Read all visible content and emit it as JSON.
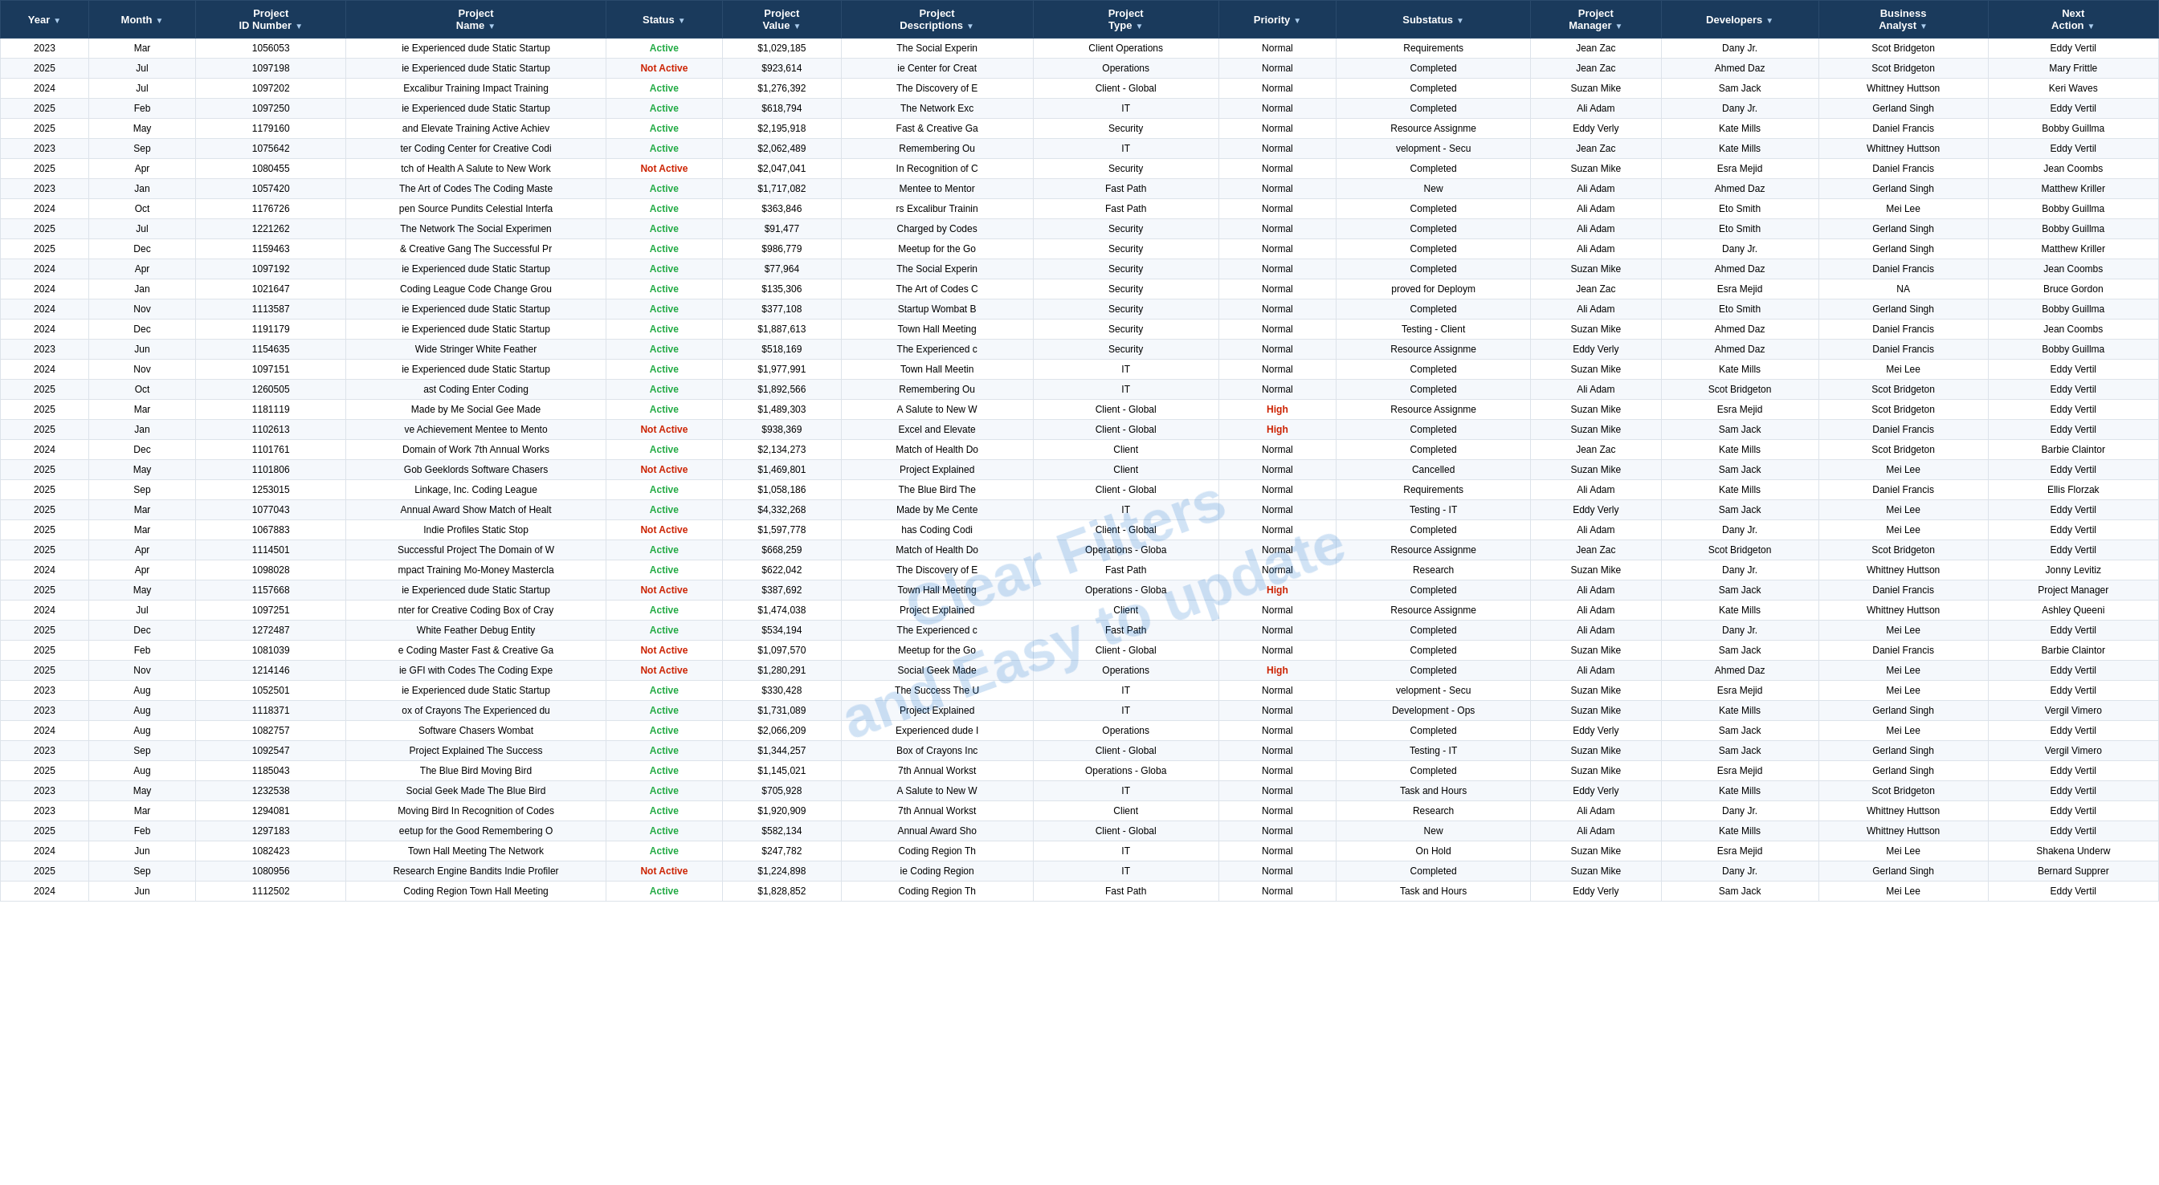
{
  "table": {
    "columns": [
      {
        "id": "year",
        "label": "Year"
      },
      {
        "id": "month",
        "label": "Month"
      },
      {
        "id": "project_id",
        "label": "Project ID Number"
      },
      {
        "id": "project_name",
        "label": "Project Name"
      },
      {
        "id": "status",
        "label": "Status"
      },
      {
        "id": "project_value",
        "label": "Project Value"
      },
      {
        "id": "project_desc",
        "label": "Project Descriptions"
      },
      {
        "id": "project_type",
        "label": "Project Type"
      },
      {
        "id": "priority",
        "label": "Priority"
      },
      {
        "id": "substatus",
        "label": "Substatus"
      },
      {
        "id": "project_manager",
        "label": "Project Manager"
      },
      {
        "id": "developers",
        "label": "Developers"
      },
      {
        "id": "business_analyst",
        "label": "Business Analyst"
      },
      {
        "id": "next_action",
        "label": "Next Action"
      }
    ],
    "rows": [
      [
        "2023",
        "Mar",
        "1056053",
        "ie Experienced dude Static Startup",
        "Active",
        "$1,029,185",
        "The Social Experin",
        "Client Operations",
        "Normal",
        "Requirements",
        "Jean Zac",
        "Dany Jr.",
        "Scot Bridgeton",
        "Eddy Vertil"
      ],
      [
        "2025",
        "Jul",
        "1097198",
        "ie Experienced dude Static Startup",
        "Not Active",
        "$923,614",
        "ie Center for Creat",
        "Operations",
        "Normal",
        "Completed",
        "Jean Zac",
        "Ahmed Daz",
        "Scot Bridgeton",
        "Mary Frittle"
      ],
      [
        "2024",
        "Jul",
        "1097202",
        "Excalibur Training Impact Training",
        "Active",
        "$1,276,392",
        "The Discovery of E",
        "Client - Global",
        "Normal",
        "Completed",
        "Suzan Mike",
        "Sam Jack",
        "Whittney Huttson",
        "Keri Waves"
      ],
      [
        "2025",
        "Feb",
        "1097250",
        "ie Experienced dude Static Startup",
        "Active",
        "$618,794",
        "The Network Exc",
        "IT",
        "Normal",
        "Completed",
        "Ali Adam",
        "Dany Jr.",
        "Gerland Singh",
        "Eddy Vertil"
      ],
      [
        "2025",
        "May",
        "1179160",
        "and Elevate Training Active Achiev",
        "Active",
        "$2,195,918",
        "Fast & Creative Ga",
        "Security",
        "Normal",
        "Resource Assignme",
        "Eddy Verly",
        "Kate Mills",
        "Daniel Francis",
        "Bobby Guillma"
      ],
      [
        "2023",
        "Sep",
        "1075642",
        "ter Coding Center for Creative Codi",
        "Active",
        "$2,062,489",
        "Remembering Ou",
        "IT",
        "Normal",
        "velopment - Secu",
        "Jean Zac",
        "Kate Mills",
        "Whittney Huttson",
        "Eddy Vertil"
      ],
      [
        "2025",
        "Apr",
        "1080455",
        "tch of Health A Salute to New Work",
        "Not Active",
        "$2,047,041",
        "In Recognition of C",
        "Security",
        "Normal",
        "Completed",
        "Suzan Mike",
        "Esra Mejid",
        "Daniel Francis",
        "Jean Coombs"
      ],
      [
        "2023",
        "Jan",
        "1057420",
        "The Art of Codes The Coding Maste",
        "Active",
        "$1,717,082",
        "Mentee to Mentor",
        "Fast Path",
        "Normal",
        "New",
        "Ali Adam",
        "Ahmed Daz",
        "Gerland Singh",
        "Matthew Kriller"
      ],
      [
        "2024",
        "Oct",
        "1176726",
        "pen Source Pundits Celestial Interfa",
        "Active",
        "$363,846",
        "rs Excalibur Trainin",
        "Fast Path",
        "Normal",
        "Completed",
        "Ali Adam",
        "Eto Smith",
        "Mei Lee",
        "Bobby Guillma"
      ],
      [
        "2025",
        "Jul",
        "1221262",
        "The Network The Social Experimen",
        "Active",
        "$91,477",
        "Charged by Codes",
        "Security",
        "Normal",
        "Completed",
        "Ali Adam",
        "Eto Smith",
        "Gerland Singh",
        "Bobby Guillma"
      ],
      [
        "2025",
        "Dec",
        "1159463",
        "& Creative Gang The Successful Pr",
        "Active",
        "$986,779",
        "Meetup for the Go",
        "Security",
        "Normal",
        "Completed",
        "Ali Adam",
        "Dany Jr.",
        "Gerland Singh",
        "Matthew Kriller"
      ],
      [
        "2024",
        "Apr",
        "1097192",
        "ie Experienced dude Static Startup",
        "Active",
        "$77,964",
        "The Social Experin",
        "Security",
        "Normal",
        "Completed",
        "Suzan Mike",
        "Ahmed Daz",
        "Daniel Francis",
        "Jean Coombs"
      ],
      [
        "2024",
        "Jan",
        "1021647",
        "Coding League Code Change Grou",
        "Active",
        "$135,306",
        "The Art of Codes C",
        "Security",
        "Normal",
        "proved for Deploym",
        "Jean Zac",
        "Esra Mejid",
        "NA",
        "Bruce Gordon"
      ],
      [
        "2024",
        "Nov",
        "1113587",
        "ie Experienced dude Static Startup",
        "Active",
        "$377,108",
        "Startup Wombat B",
        "Security",
        "Normal",
        "Completed",
        "Ali Adam",
        "Eto Smith",
        "Gerland Singh",
        "Bobby Guillma"
      ],
      [
        "2024",
        "Dec",
        "1191179",
        "ie Experienced dude Static Startup",
        "Active",
        "$1,887,613",
        "Town Hall Meeting",
        "Security",
        "Normal",
        "Testing - Client",
        "Suzan Mike",
        "Ahmed Daz",
        "Daniel Francis",
        "Jean Coombs"
      ],
      [
        "2023",
        "Jun",
        "1154635",
        "Wide Stringer White Feather",
        "Active",
        "$518,169",
        "The Experienced c",
        "Security",
        "Normal",
        "Resource Assignme",
        "Eddy Verly",
        "Ahmed Daz",
        "Daniel Francis",
        "Bobby Guillma"
      ],
      [
        "2024",
        "Nov",
        "1097151",
        "ie Experienced dude Static Startup",
        "Active",
        "$1,977,991",
        "Town Hall Meetin",
        "IT",
        "Normal",
        "Completed",
        "Suzan Mike",
        "Kate Mills",
        "Mei Lee",
        "Eddy Vertil"
      ],
      [
        "2025",
        "Oct",
        "1260505",
        "ast Coding Enter Coding",
        "Active",
        "$1,892,566",
        "Remembering Ou",
        "IT",
        "Normal",
        "Completed",
        "Ali Adam",
        "Scot Bridgeton",
        "Scot Bridgeton",
        "Eddy Vertil"
      ],
      [
        "2025",
        "Mar",
        "1181119",
        "Made by Me Social Gee Made",
        "Active",
        "$1,489,303",
        "A Salute to New W",
        "Client - Global",
        "High",
        "Resource Assignme",
        "Suzan Mike",
        "Esra Mejid",
        "Scot Bridgeton",
        "Eddy Vertil"
      ],
      [
        "2025",
        "Jan",
        "1102613",
        "ve Achievement Mentee to Mento",
        "Not Active",
        "$938,369",
        "Excel and Elevate",
        "Client - Global",
        "High",
        "Completed",
        "Suzan Mike",
        "Sam Jack",
        "Daniel Francis",
        "Eddy Vertil"
      ],
      [
        "2024",
        "Dec",
        "1101761",
        "Domain of Work 7th Annual Works",
        "Active",
        "$2,134,273",
        "Match of Health Do",
        "Client",
        "Normal",
        "Completed",
        "Jean Zac",
        "Kate Mills",
        "Scot Bridgeton",
        "Barbie Claintor"
      ],
      [
        "2025",
        "May",
        "1101806",
        "Gob Geeklords Software Chasers",
        "Not Active",
        "$1,469,801",
        "Project Explained",
        "Client",
        "Normal",
        "Cancelled",
        "Suzan Mike",
        "Sam Jack",
        "Mei Lee",
        "Eddy Vertil"
      ],
      [
        "2025",
        "Sep",
        "1253015",
        "Linkage, Inc. Coding League",
        "Active",
        "$1,058,186",
        "The Blue Bird The",
        "Client - Global",
        "Normal",
        "Requirements",
        "Ali Adam",
        "Kate Mills",
        "Daniel Francis",
        "Ellis Florzak"
      ],
      [
        "2025",
        "Mar",
        "1077043",
        "Annual Award Show Match of Healt",
        "Active",
        "$4,332,268",
        "Made by Me Cente",
        "IT",
        "Normal",
        "Testing - IT",
        "Eddy Verly",
        "Sam Jack",
        "Mei Lee",
        "Eddy Vertil"
      ],
      [
        "2025",
        "Mar",
        "1067883",
        "Indie Profiles Static Stop",
        "Not Active",
        "$1,597,778",
        "has Coding Codi",
        "Client - Global",
        "Normal",
        "Completed",
        "Ali Adam",
        "Dany Jr.",
        "Mei Lee",
        "Eddy Vertil"
      ],
      [
        "2025",
        "Apr",
        "1114501",
        "Successful Project The Domain of W",
        "Active",
        "$668,259",
        "Match of Health Do",
        "Operations - Globa",
        "Normal",
        "Resource Assignme",
        "Jean Zac",
        "Scot Bridgeton",
        "Scot Bridgeton",
        "Eddy Vertil"
      ],
      [
        "2024",
        "Apr",
        "1098028",
        "mpact Training Mo-Money Mastercla",
        "Active",
        "$622,042",
        "The Discovery of E",
        "Fast Path",
        "Normal",
        "Research",
        "Suzan Mike",
        "Dany Jr.",
        "Whittney Huttson",
        "Jonny Levitiz"
      ],
      [
        "2025",
        "May",
        "1157668",
        "ie Experienced dude Static Startup",
        "Not Active",
        "$387,692",
        "Town Hall Meeting",
        "Operations - Globa",
        "High",
        "Completed",
        "Ali Adam",
        "Sam Jack",
        "Daniel Francis",
        "Project Manager"
      ],
      [
        "2024",
        "Jul",
        "1097251",
        "nter for Creative Coding Box of Cray",
        "Active",
        "$1,474,038",
        "Project Explained",
        "Client",
        "Normal",
        "Resource Assignme",
        "Ali Adam",
        "Kate Mills",
        "Whittney Huttson",
        "Ashley Queeni"
      ],
      [
        "2025",
        "Dec",
        "1272487",
        "White Feather Debug Entity",
        "Active",
        "$534,194",
        "The Experienced c",
        "Fast Path",
        "Normal",
        "Completed",
        "Ali Adam",
        "Dany Jr.",
        "Mei Lee",
        "Eddy Vertil"
      ],
      [
        "2025",
        "Feb",
        "1081039",
        "e Coding Master Fast & Creative Ga",
        "Not Active",
        "$1,097,570",
        "Meetup for the Go",
        "Client - Global",
        "Normal",
        "Completed",
        "Suzan Mike",
        "Sam Jack",
        "Daniel Francis",
        "Barbie Claintor"
      ],
      [
        "2025",
        "Nov",
        "1214146",
        "ie GFI with Codes The Coding Expe",
        "Not Active",
        "$1,280,291",
        "Social Geek Made",
        "Operations",
        "High",
        "Completed",
        "Ali Adam",
        "Ahmed Daz",
        "Mei Lee",
        "Eddy Vertil"
      ],
      [
        "2023",
        "Aug",
        "1052501",
        "ie Experienced dude Static Startup",
        "Active",
        "$330,428",
        "The Success The U",
        "IT",
        "Normal",
        "velopment - Secu",
        "Suzan Mike",
        "Esra Mejid",
        "Mei Lee",
        "Eddy Vertil"
      ],
      [
        "2023",
        "Aug",
        "1118371",
        "ox of Crayons The Experienced du",
        "Active",
        "$1,731,089",
        "Project Explained",
        "IT",
        "Normal",
        "Development - Ops",
        "Suzan Mike",
        "Kate Mills",
        "Gerland Singh",
        "Vergil Vimero"
      ],
      [
        "2024",
        "Aug",
        "1082757",
        "Software Chasers Wombat",
        "Active",
        "$2,066,209",
        "Experienced dude I",
        "Operations",
        "Normal",
        "Completed",
        "Eddy Verly",
        "Sam Jack",
        "Mei Lee",
        "Eddy Vertil"
      ],
      [
        "2023",
        "Sep",
        "1092547",
        "Project Explained The Success",
        "Active",
        "$1,344,257",
        "Box of Crayons Inc",
        "Client - Global",
        "Normal",
        "Testing - IT",
        "Suzan Mike",
        "Sam Jack",
        "Gerland Singh",
        "Vergil Vimero"
      ],
      [
        "2025",
        "Aug",
        "1185043",
        "The Blue Bird Moving Bird",
        "Active",
        "$1,145,021",
        "7th Annual Workst",
        "Operations - Globa",
        "Normal",
        "Completed",
        "Suzan Mike",
        "Esra Mejid",
        "Gerland Singh",
        "Eddy Vertil"
      ],
      [
        "2023",
        "May",
        "1232538",
        "Social Geek Made The Blue Bird",
        "Active",
        "$705,928",
        "A Salute to New W",
        "IT",
        "Normal",
        "Task and Hours",
        "Eddy Verly",
        "Kate Mills",
        "Scot Bridgeton",
        "Eddy Vertil"
      ],
      [
        "2023",
        "Mar",
        "1294081",
        "Moving Bird In Recognition of Codes",
        "Active",
        "$1,920,909",
        "7th Annual Workst",
        "Client",
        "Normal",
        "Research",
        "Ali Adam",
        "Dany Jr.",
        "Whittney Huttson",
        "Eddy Vertil"
      ],
      [
        "2025",
        "Feb",
        "1297183",
        "eetup for the Good Remembering O",
        "Active",
        "$582,134",
        "Annual Award Sho",
        "Client - Global",
        "Normal",
        "New",
        "Ali Adam",
        "Kate Mills",
        "Whittney Huttson",
        "Eddy Vertil"
      ],
      [
        "2024",
        "Jun",
        "1082423",
        "Town Hall Meeting The Network",
        "Active",
        "$247,782",
        "Coding Region Th",
        "IT",
        "Normal",
        "On Hold",
        "Suzan Mike",
        "Esra Mejid",
        "Mei Lee",
        "Shakena Underw"
      ],
      [
        "2025",
        "Sep",
        "1080956",
        "Research Engine Bandits Indie Profiler",
        "Not Active",
        "$1,224,898",
        "ie Coding Region",
        "IT",
        "Normal",
        "Completed",
        "Suzan Mike",
        "Dany Jr.",
        "Gerland Singh",
        "Bernard Supprer"
      ],
      [
        "2024",
        "Jun",
        "1112502",
        "Coding Region Town Hall Meeting",
        "Active",
        "$1,828,852",
        "Coding Region Th",
        "Fast Path",
        "Normal",
        "Task and Hours",
        "Eddy Verly",
        "Sam Jack",
        "Mei Lee",
        "Eddy Vertil"
      ]
    ]
  },
  "watermark": {
    "line1": "Clear Filters",
    "line2": "and Easy to update"
  }
}
